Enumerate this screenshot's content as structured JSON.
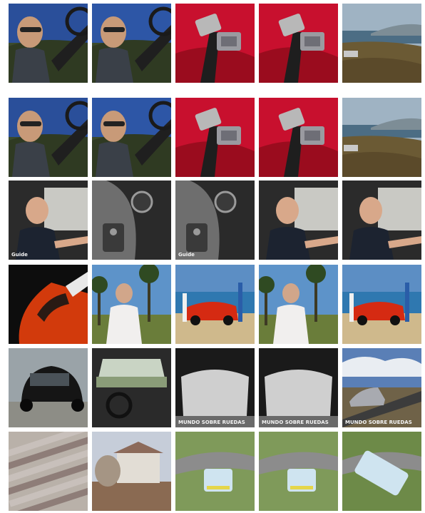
{
  "grid": {
    "rows": [
      {
        "frames": [
          {
            "scene": "driver-sunglasses",
            "sky": "#2a4f9a",
            "ground": "#3b4a2c",
            "accent": "#222222"
          },
          {
            "scene": "driver-sunglasses",
            "sky": "#2d56a6",
            "ground": "#3b4a2c",
            "accent": "#222222"
          },
          {
            "scene": "seatbelt-buckle",
            "sky": "#c8102e",
            "ground": "#9a0c1e",
            "accent": "#b8b8b8"
          },
          {
            "scene": "seatbelt-buckle",
            "sky": "#c8102e",
            "ground": "#9a0c1e",
            "accent": "#b8b8b8"
          },
          {
            "scene": "coast-hills",
            "sky": "#9fb3c3",
            "ground": "#6b5a34",
            "accent": "#4c6d84"
          }
        ]
      },
      {
        "frames": [
          {
            "scene": "driver-sunglasses",
            "sky": "#2a4f9a",
            "ground": "#3b4a2c",
            "accent": "#222222"
          },
          {
            "scene": "driver-sunglasses",
            "sky": "#2d56a6",
            "ground": "#3b4a2c",
            "accent": "#222222"
          },
          {
            "scene": "seatbelt-buckle",
            "sky": "#c8102e",
            "ground": "#9a0c1e",
            "accent": "#b8b8b8"
          },
          {
            "scene": "seatbelt-buckle",
            "sky": "#c8102e",
            "ground": "#9a0c1e",
            "accent": "#b8b8b8"
          },
          {
            "scene": "coast-hills",
            "sky": "#9fb3c3",
            "ground": "#6b5a34",
            "accent": "#4c6d84"
          }
        ]
      },
      {
        "frames": [
          {
            "scene": "man-driving",
            "sky": "#c9c9c4",
            "ground": "#2b2b2b",
            "accent": "#d8a88a",
            "caption": "Guide"
          },
          {
            "scene": "car-controls",
            "sky": "#6e6e6e",
            "ground": "#2a2a2a",
            "accent": "#9a9a9a"
          },
          {
            "scene": "car-controls",
            "sky": "#6e6e6e",
            "ground": "#2a2a2a",
            "accent": "#9a9a9a",
            "caption": "Guide"
          },
          {
            "scene": "man-driving",
            "sky": "#c9c9c4",
            "ground": "#2b2b2b",
            "accent": "#d8a88a"
          },
          {
            "scene": "man-driving",
            "sky": "#c9c9c4",
            "ground": "#2b2b2b",
            "accent": "#d8a88a"
          }
        ]
      },
      {
        "frames": [
          {
            "scene": "orange-vent",
            "sky": "#0d0d0d",
            "ground": "#d23a0c",
            "accent": "#e8e8e8"
          },
          {
            "scene": "man-palms",
            "sky": "#5d93c9",
            "ground": "#6a7d3a",
            "accent": "#f1efee"
          },
          {
            "scene": "beach-car",
            "sky": "#5c8ec4",
            "ground": "#cfb98c",
            "accent": "#d52a12"
          },
          {
            "scene": "man-palms",
            "sky": "#5d93c9",
            "ground": "#6a7d3a",
            "accent": "#f1efee"
          },
          {
            "scene": "beach-car",
            "sky": "#5c8ec4",
            "ground": "#cfb98c",
            "accent": "#d52a12"
          }
        ]
      },
      {
        "frames": [
          {
            "scene": "black-car",
            "sky": "#9aa3a8",
            "ground": "#8d8d86",
            "accent": "#151515"
          },
          {
            "scene": "car-interior",
            "sky": "#c9d4c4",
            "ground": "#2a2a2a",
            "accent": "#8a9c78"
          },
          {
            "scene": "windshield",
            "sky": "#1a1a1a",
            "ground": "#cfcfcf",
            "accent": "#6a6a6a",
            "caption": "MUNDO SOBRE RUEDAS"
          },
          {
            "scene": "windshield",
            "sky": "#1a1a1a",
            "ground": "#cfcfcf",
            "accent": "#6a6a6a",
            "caption": "MUNDO SOBRE RUEDAS"
          },
          {
            "scene": "silver-car-road",
            "sky": "#5a7fb6",
            "ground": "#6f6248",
            "accent": "#a8aab0",
            "caption": "MUNDO SOBRE RUEDAS"
          }
        ]
      },
      {
        "frames": [
          {
            "scene": "crash-blur",
            "sky": "#b9b1a9",
            "ground": "#8e7d78",
            "accent": "#c8c0bb"
          },
          {
            "scene": "crash-house",
            "sky": "#c6cdd9",
            "ground": "#8a6a52",
            "accent": "#e2ddd5"
          },
          {
            "scene": "rally-car",
            "sky": "#3d5e3a",
            "ground": "#7f9a5a",
            "accent": "#cfe4f0"
          },
          {
            "scene": "rally-car",
            "sky": "#3d5e3a",
            "ground": "#7f9a5a",
            "accent": "#cfe4f0"
          },
          {
            "scene": "car-overturned",
            "sky": "#4f6b3f",
            "ground": "#6d8a48",
            "accent": "#cfe4f0"
          }
        ]
      }
    ]
  }
}
